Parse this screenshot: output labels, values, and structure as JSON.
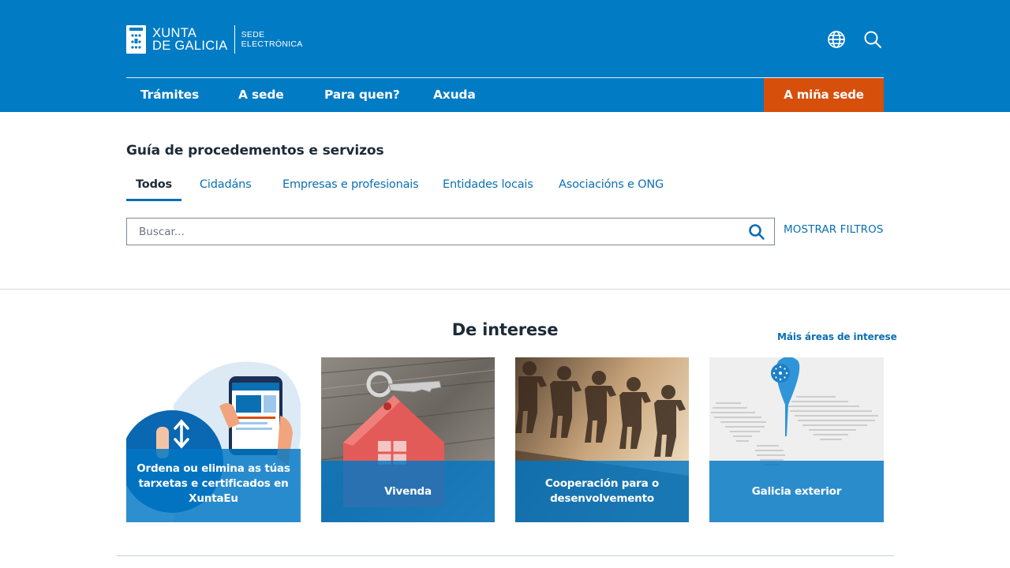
{
  "header": {
    "logo_line1": "XUNTA",
    "logo_line2": "DE GALICIA",
    "logo_sub_line1": "SEDE",
    "logo_sub_line2": "ELECTRÓNICA",
    "icons": [
      "globe-icon",
      "search-icon"
    ],
    "nav": {
      "tramites": "Trámites",
      "sede": "A sede",
      "para_quen": "Para quen?",
      "axuda": "Axuda",
      "mina_sede": "A miña sede"
    },
    "colors": {
      "bar": "#007bc4",
      "accent_button": "#d64f0b"
    }
  },
  "guide": {
    "title": "Guía de procedementos e servizos",
    "tabs": [
      "Todos",
      "Cidadáns",
      "Empresas e profesionais",
      "Entidades locais",
      "Asociacións e ONG"
    ],
    "active_tab": "Todos",
    "search_placeholder": "Buscar...",
    "search_value": "",
    "filters_link": "MOSTRAR FILTROS"
  },
  "interest": {
    "title": "De interese",
    "more_link": "Máis áreas de interese",
    "cards": [
      {
        "label": "Ordena ou elimina as túas tarxetas e certificados en XuntaEu"
      },
      {
        "label": "Vivenda"
      },
      {
        "label": "Cooperación para o desenvolvemento"
      },
      {
        "label": "Galicia exterior"
      }
    ]
  }
}
